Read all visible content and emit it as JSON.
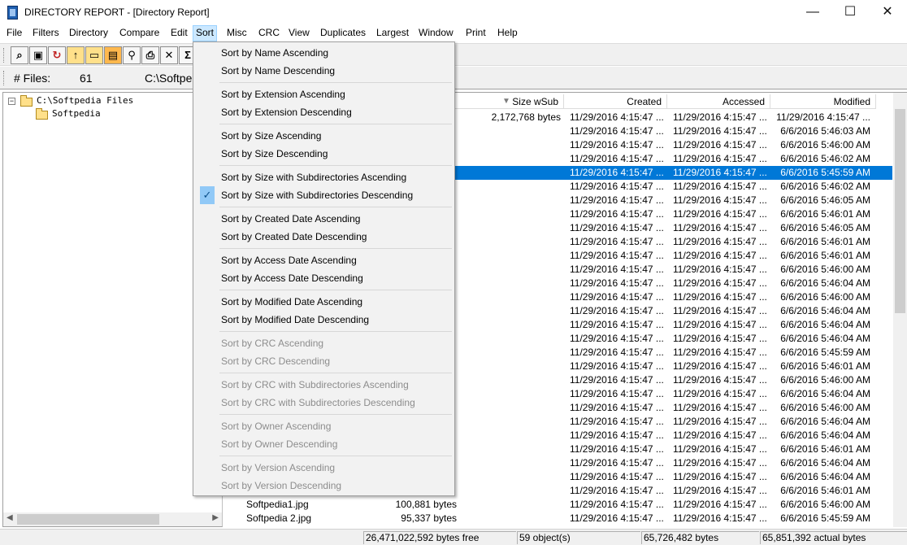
{
  "window": {
    "title": "DIRECTORY REPORT - [Directory Report]",
    "minimize": "—",
    "maximize": "☐",
    "close": "✕"
  },
  "menu": [
    "File",
    "Filters",
    "Directory",
    "Compare",
    "Edit",
    "Sort",
    "Misc",
    "CRC",
    "View",
    "Duplicates",
    "Largest",
    "Window",
    "Print",
    "Help"
  ],
  "toolbar_icons": [
    "binoculars-icon",
    "save-icon",
    "refresh-icon",
    "up-folder-icon",
    "open-folder-icon",
    "folder-color-icon",
    "search-icon",
    "print-icon",
    "delete-icon",
    "sum-icon"
  ],
  "info": {
    "files_label": "# Files:",
    "files_count": "61",
    "path": "C:\\Softpe"
  },
  "tree": {
    "root": "C:\\Softpedia Files",
    "child": "Softpedia"
  },
  "columns": {
    "size_wsub": "Size wSub",
    "created": "Created",
    "accessed": "Accessed",
    "modified": "Modified"
  },
  "rows": [
    {
      "name": "",
      "size": "",
      "size_wsub": "2,172,768 bytes",
      "created": "11/29/2016 4:15:47 ...",
      "accessed": "11/29/2016 4:15:47 ...",
      "modified": "11/29/2016 4:15:47 ..."
    },
    {
      "name": "",
      "size": "",
      "size_wsub": "",
      "created": "11/29/2016 4:15:47 ...",
      "accessed": "11/29/2016 4:15:47 ...",
      "modified": "6/6/2016 5:46:03 AM"
    },
    {
      "name": "",
      "size": "",
      "size_wsub": "",
      "created": "11/29/2016 4:15:47 ...",
      "accessed": "11/29/2016 4:15:47 ...",
      "modified": "6/6/2016 5:46:00 AM"
    },
    {
      "name": "",
      "size": "",
      "size_wsub": "",
      "created": "11/29/2016 4:15:47 ...",
      "accessed": "11/29/2016 4:15:47 ...",
      "modified": "6/6/2016 5:46:02 AM"
    },
    {
      "name": "",
      "size": "",
      "size_wsub": "",
      "created": "11/29/2016 4:15:47 ...",
      "accessed": "11/29/2016 4:15:47 ...",
      "modified": "6/6/2016 5:45:59 AM",
      "selected": true
    },
    {
      "name": "",
      "size": "",
      "size_wsub": "",
      "created": "11/29/2016 4:15:47 ...",
      "accessed": "11/29/2016 4:15:47 ...",
      "modified": "6/6/2016 5:46:02 AM"
    },
    {
      "name": "",
      "size": "",
      "size_wsub": "",
      "created": "11/29/2016 4:15:47 ...",
      "accessed": "11/29/2016 4:15:47 ...",
      "modified": "6/6/2016 5:46:05 AM"
    },
    {
      "name": "",
      "size": "",
      "size_wsub": "",
      "created": "11/29/2016 4:15:47 ...",
      "accessed": "11/29/2016 4:15:47 ...",
      "modified": "6/6/2016 5:46:01 AM"
    },
    {
      "name": "",
      "size": "",
      "size_wsub": "",
      "created": "11/29/2016 4:15:47 ...",
      "accessed": "11/29/2016 4:15:47 ...",
      "modified": "6/6/2016 5:46:05 AM"
    },
    {
      "name": "",
      "size": "",
      "size_wsub": "",
      "created": "11/29/2016 4:15:47 ...",
      "accessed": "11/29/2016 4:15:47 ...",
      "modified": "6/6/2016 5:46:01 AM"
    },
    {
      "name": "",
      "size": "",
      "size_wsub": "",
      "created": "11/29/2016 4:15:47 ...",
      "accessed": "11/29/2016 4:15:47 ...",
      "modified": "6/6/2016 5:46:01 AM"
    },
    {
      "name": "",
      "size": "",
      "size_wsub": "",
      "created": "11/29/2016 4:15:47 ...",
      "accessed": "11/29/2016 4:15:47 ...",
      "modified": "6/6/2016 5:46:00 AM"
    },
    {
      "name": "",
      "size": "",
      "size_wsub": "",
      "created": "11/29/2016 4:15:47 ...",
      "accessed": "11/29/2016 4:15:47 ...",
      "modified": "6/6/2016 5:46:04 AM"
    },
    {
      "name": "",
      "size": "",
      "size_wsub": "",
      "created": "11/29/2016 4:15:47 ...",
      "accessed": "11/29/2016 4:15:47 ...",
      "modified": "6/6/2016 5:46:00 AM"
    },
    {
      "name": "",
      "size": "",
      "size_wsub": "",
      "created": "11/29/2016 4:15:47 ...",
      "accessed": "11/29/2016 4:15:47 ...",
      "modified": "6/6/2016 5:46:04 AM"
    },
    {
      "name": "",
      "size": "",
      "size_wsub": "",
      "created": "11/29/2016 4:15:47 ...",
      "accessed": "11/29/2016 4:15:47 ...",
      "modified": "6/6/2016 5:46:04 AM"
    },
    {
      "name": "",
      "size": "",
      "size_wsub": "",
      "created": "11/29/2016 4:15:47 ...",
      "accessed": "11/29/2016 4:15:47 ...",
      "modified": "6/6/2016 5:46:04 AM"
    },
    {
      "name": "",
      "size": "",
      "size_wsub": "",
      "created": "11/29/2016 4:15:47 ...",
      "accessed": "11/29/2016 4:15:47 ...",
      "modified": "6/6/2016 5:45:59 AM"
    },
    {
      "name": "",
      "size": "",
      "size_wsub": "",
      "created": "11/29/2016 4:15:47 ...",
      "accessed": "11/29/2016 4:15:47 ...",
      "modified": "6/6/2016 5:46:01 AM"
    },
    {
      "name": "",
      "size": "",
      "size_wsub": "",
      "created": "11/29/2016 4:15:47 ...",
      "accessed": "11/29/2016 4:15:47 ...",
      "modified": "6/6/2016 5:46:00 AM"
    },
    {
      "name": "",
      "size": "",
      "size_wsub": "",
      "created": "11/29/2016 4:15:47 ...",
      "accessed": "11/29/2016 4:15:47 ...",
      "modified": "6/6/2016 5:46:04 AM"
    },
    {
      "name": "",
      "size": "",
      "size_wsub": "",
      "created": "11/29/2016 4:15:47 ...",
      "accessed": "11/29/2016 4:15:47 ...",
      "modified": "6/6/2016 5:46:00 AM"
    },
    {
      "name": "",
      "size": "",
      "size_wsub": "",
      "created": "11/29/2016 4:15:47 ...",
      "accessed": "11/29/2016 4:15:47 ...",
      "modified": "6/6/2016 5:46:04 AM"
    },
    {
      "name": "",
      "size": "",
      "size_wsub": "",
      "created": "11/29/2016 4:15:47 ...",
      "accessed": "11/29/2016 4:15:47 ...",
      "modified": "6/6/2016 5:46:04 AM"
    },
    {
      "name": "",
      "size": "",
      "size_wsub": "",
      "created": "11/29/2016 4:15:47 ...",
      "accessed": "11/29/2016 4:15:47 ...",
      "modified": "6/6/2016 5:46:01 AM"
    },
    {
      "name": "",
      "size": "",
      "size_wsub": "",
      "created": "11/29/2016 4:15:47 ...",
      "accessed": "11/29/2016 4:15:47 ...",
      "modified": "6/6/2016 5:46:04 AM"
    },
    {
      "name": "",
      "size": "",
      "size_wsub": "",
      "created": "11/29/2016 4:15:47 ...",
      "accessed": "11/29/2016 4:15:47 ...",
      "modified": "6/6/2016 5:46:04 AM"
    },
    {
      "name": "",
      "size": "",
      "size_wsub": "",
      "created": "11/29/2016 4:15:47 ...",
      "accessed": "11/29/2016 4:15:47 ...",
      "modified": "6/6/2016 5:46:01 AM"
    },
    {
      "name": "Softpedia1.jpg",
      "size": "100,881 bytes",
      "size_wsub": "",
      "created": "11/29/2016 4:15:47 ...",
      "accessed": "11/29/2016 4:15:47 ...",
      "modified": "6/6/2016 5:46:00 AM"
    },
    {
      "name": "Softpedia 2.jpg",
      "size": "95,337 bytes",
      "size_wsub": "",
      "created": "11/29/2016 4:15:47 ...",
      "accessed": "11/29/2016 4:15:47 ...",
      "modified": "6/6/2016 5:45:59 AM"
    }
  ],
  "sort_menu": {
    "groups": [
      [
        {
          "label": "Sort by Name Ascending"
        },
        {
          "label": "Sort by Name Descending"
        }
      ],
      [
        {
          "label": "Sort by Extension Ascending"
        },
        {
          "label": "Sort by Extension Descending"
        }
      ],
      [
        {
          "label": "Sort by Size Ascending"
        },
        {
          "label": "Sort by Size Descending"
        }
      ],
      [
        {
          "label": "Sort by Size with Subdirectories Ascending"
        },
        {
          "label": "Sort by Size with Subdirectories Descending",
          "checked": true
        }
      ],
      [
        {
          "label": "Sort by Created Date Ascending"
        },
        {
          "label": "Sort by Created Date Descending"
        }
      ],
      [
        {
          "label": "Sort by Access Date Ascending"
        },
        {
          "label": "Sort by Access Date Descending"
        }
      ],
      [
        {
          "label": "Sort by Modified Date Ascending"
        },
        {
          "label": "Sort by Modified Date Descending"
        }
      ],
      [
        {
          "label": "Sort by CRC Ascending",
          "disabled": true
        },
        {
          "label": "Sort by CRC Descending",
          "disabled": true
        }
      ],
      [
        {
          "label": "Sort by CRC with Subdirectories Ascending",
          "disabled": true
        },
        {
          "label": "Sort by CRC with Subdirectories Descending",
          "disabled": true
        }
      ],
      [
        {
          "label": "Sort by Owner Ascending",
          "disabled": true
        },
        {
          "label": "Sort by Owner Descending",
          "disabled": true
        }
      ],
      [
        {
          "label": "Sort by Version Ascending",
          "disabled": true
        },
        {
          "label": "Sort by Version Descending",
          "disabled": true
        }
      ]
    ]
  },
  "status": {
    "free": "26,471,022,592 bytes free",
    "objects": "59 object(s)",
    "bytes": "65,726,482 bytes",
    "actual": "65,851,392 actual bytes"
  }
}
